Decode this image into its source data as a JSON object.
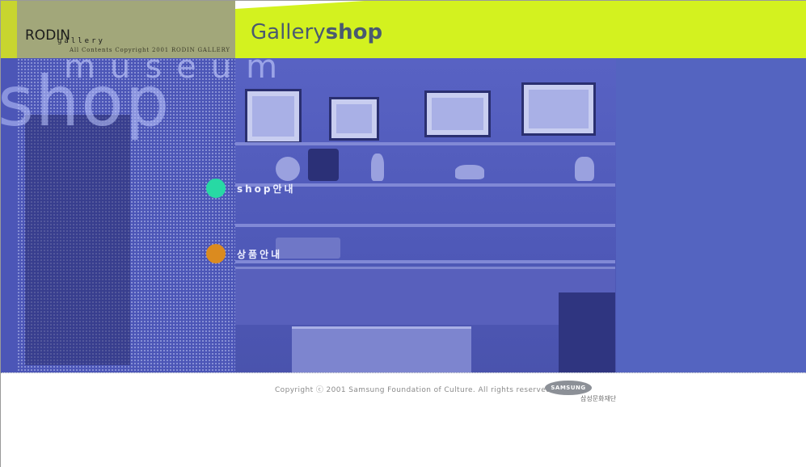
{
  "header": {
    "brand": "RODIN",
    "brand_sub": "gallery",
    "copyright": "All Contents Copyright 2001 RODIN GALLERY",
    "title_light": "Gallery",
    "title_bold": "shop"
  },
  "hero": {
    "word_large": "shop",
    "word_spaced": "museum"
  },
  "menu": {
    "items": [
      {
        "label": "shop안내",
        "color": "#27d9a4"
      },
      {
        "label": "상품안내",
        "color": "#db8b1f"
      }
    ]
  },
  "footer": {
    "copyright": "Copyright ⓒ 2001 Samsung Foundation of Culture. All rights reserved.",
    "samsung_logo": "SAMSUNG",
    "foundation": "삼성문화재단"
  },
  "colors": {
    "header_bg": "#d3f21f",
    "hero_bg": "#4c56b7",
    "accent_teal": "#27d9a4",
    "accent_orange": "#db8b1f"
  }
}
